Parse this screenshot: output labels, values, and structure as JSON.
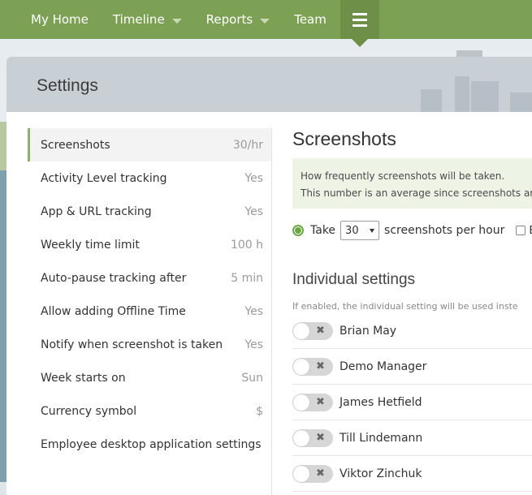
{
  "nav": {
    "items": [
      {
        "label": "My Home"
      },
      {
        "label": "Timeline"
      },
      {
        "label": "Reports"
      },
      {
        "label": "Team"
      }
    ],
    "menu_icon": "hamburger-icon"
  },
  "panel": {
    "title": "Settings"
  },
  "menu": {
    "items": [
      {
        "label": "Screenshots",
        "value": "30/hr"
      },
      {
        "label": "Activity Level tracking",
        "value": "Yes"
      },
      {
        "label": "App & URL tracking",
        "value": "Yes"
      },
      {
        "label": "Weekly time limit",
        "value": "100 h"
      },
      {
        "label": "Auto-pause tracking after",
        "value": "5 min"
      },
      {
        "label": "Allow adding Offline Time",
        "value": "Yes"
      },
      {
        "label": "Notify when screenshot is taken",
        "value": "Yes"
      },
      {
        "label": "Week starts on",
        "value": "Sun"
      },
      {
        "label": "Currency symbol",
        "value": "$"
      },
      {
        "label": "Employee desktop application settings",
        "value": ""
      }
    ]
  },
  "content": {
    "title": "Screenshots",
    "info_line1": "How frequently screenshots will be taken.",
    "info_line2": "This number is an average since screenshots ar",
    "take_label": "Take",
    "select_value": "30",
    "per_hour_label": "screenshots per hour",
    "checkbox_label": "B",
    "individual_title": "Individual settings",
    "individual_desc": "If enabled, the individual setting will be used inste",
    "people": [
      {
        "name": "Brian May"
      },
      {
        "name": "Demo Manager"
      },
      {
        "name": "James Hetfield"
      },
      {
        "name": "Till Lindemann"
      },
      {
        "name": "Viktor Zinchuk"
      }
    ]
  },
  "colors": {
    "nav_bg": "#7da154",
    "accent": "#6ba842"
  }
}
